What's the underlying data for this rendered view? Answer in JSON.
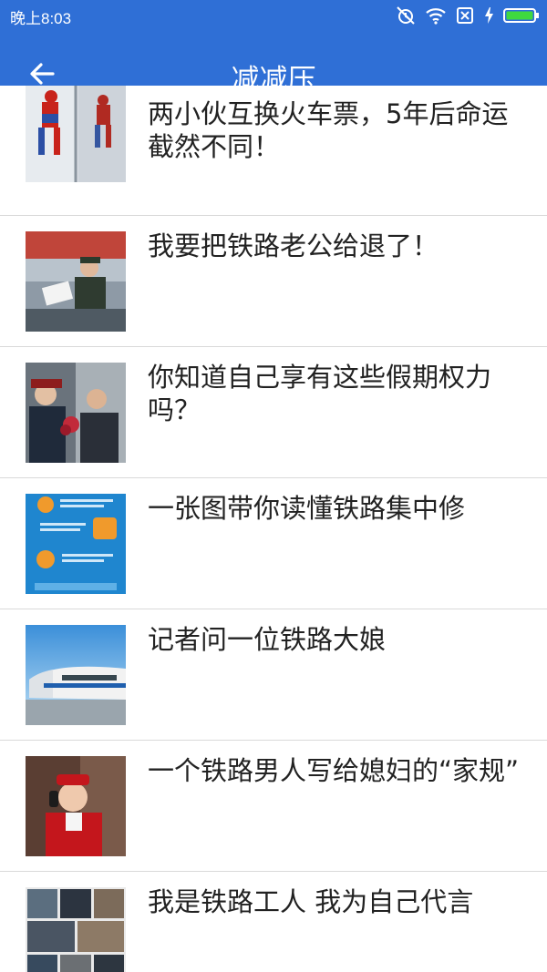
{
  "status_bar": {
    "time": "晚上8:03",
    "icons": [
      "alarm-off-icon",
      "wifi-icon",
      "sim-off-icon",
      "charging-icon",
      "battery-icon"
    ]
  },
  "app_bar": {
    "title": "减减压",
    "back_icon": "arrow-left-icon"
  },
  "colors": {
    "primary": "#2f6fd6",
    "divider": "#d9d9d9",
    "text": "#222222"
  },
  "articles": [
    {
      "title": "两小伙互换火车票，5年后命运截然不同！",
      "thumb": "spiderman-window-cleaner"
    },
    {
      "title": "我要把铁路老公给退了！",
      "thumb": "railway-worker-with-ticket"
    },
    {
      "title": "你知道自己享有这些假期权力吗？",
      "thumb": "railway-staff-and-flowers"
    },
    {
      "title": "一张图带你读懂铁路集中修",
      "thumb": "infographic-blue"
    },
    {
      "title": "记者问一位铁路大娘",
      "thumb": "high-speed-train"
    },
    {
      "title": "一个铁路男人写给媳妇的“家规”",
      "thumb": "train-attendant-on-phone"
    },
    {
      "title": "我是铁路工人 我为自己代言",
      "thumb": "photo-collage"
    }
  ]
}
